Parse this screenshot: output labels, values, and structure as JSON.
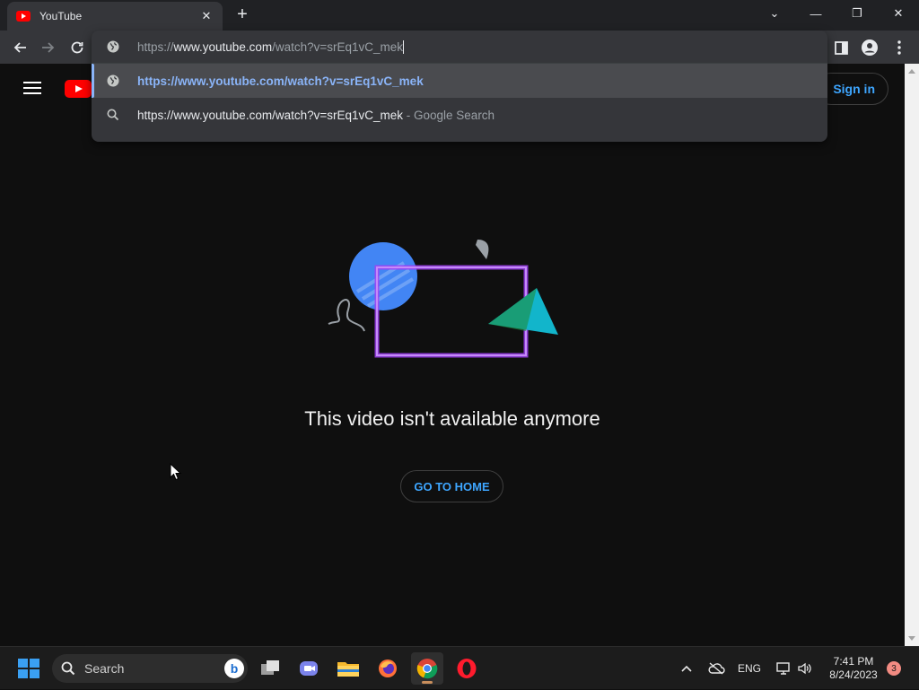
{
  "browser": {
    "tab": {
      "title": "YouTube",
      "close_glyph": "✕"
    },
    "new_tab_glyph": "+",
    "window_controls": {
      "dropdown": "⌄",
      "minimize": "—",
      "restore": "❐",
      "close": "✕"
    },
    "omnibox": {
      "url_prefix": "https://",
      "url_host": "www.youtube.com",
      "url_rest": "/watch?v=srEq1vC_mek",
      "suggestions": [
        {
          "text": "https://www.youtube.com/watch?v=srEq1vC_mek",
          "hint": "",
          "icon": "globe-icon",
          "selected": true
        },
        {
          "text": "https://www.youtube.com/watch?v=srEq1vC_mek",
          "hint": " - Google Search",
          "icon": "search-icon",
          "selected": false
        }
      ]
    }
  },
  "youtube": {
    "sign_in_label": "Sign in",
    "error_message": "This video isn't available anymore",
    "home_button_label": "GO TO HOME"
  },
  "taskbar": {
    "search_label": "Search",
    "bing_glyph": "b",
    "language": "ENG",
    "time": "7:41 PM",
    "date": "8/24/2023",
    "notification_count": "3"
  },
  "colors": {
    "youtube_red": "#ff0000",
    "link_blue": "#3ea6ff",
    "omnibox_accent": "#8ab4f8"
  }
}
